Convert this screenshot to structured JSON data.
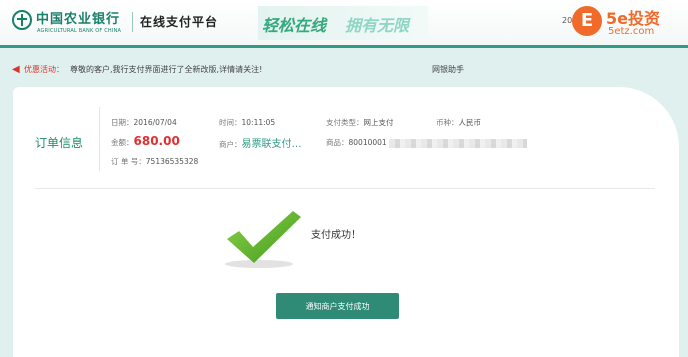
{
  "header": {
    "bank_name": "中国农业银行",
    "bank_name_en": "AGRICULTURAL BANK OF CHINA",
    "platform_title": "在线支付平台",
    "slogan_1": "轻松在线",
    "slogan_2": "拥有无限",
    "date_text": "2016"
  },
  "watermark": {
    "logo_char": "E",
    "brand": "5e投资",
    "url": "5etz.com"
  },
  "notice": {
    "label": "优惠活动：",
    "text": "尊敬的客户,我行支付界面进行了全新改版,详情请关注!",
    "link": "网银助手"
  },
  "order": {
    "title": "订单信息",
    "date_label": "日期：",
    "date_value": "2016/07/04",
    "time_label": "时间：",
    "time_value": "10:11:05",
    "paytype_label": "支付类型：",
    "paytype_value": "网上支付",
    "currency_label": "币种：",
    "currency_value": "人民币",
    "amount_label": "金额：",
    "amount_value": "680.00",
    "merchant_label": "商户：",
    "merchant_value": "易票联支付…",
    "product_label": "商品：",
    "product_value": "80010001",
    "order_no_label": "订 单 号：",
    "order_no_value": "75136535328"
  },
  "result": {
    "message": "支付成功！",
    "notify_button": "通知商户支付成功"
  },
  "colors": {
    "brand_green": "#2f9b86",
    "amount_red": "#e03030",
    "notice_red": "#d9342b",
    "watermark_orange": "#f06a2a"
  }
}
